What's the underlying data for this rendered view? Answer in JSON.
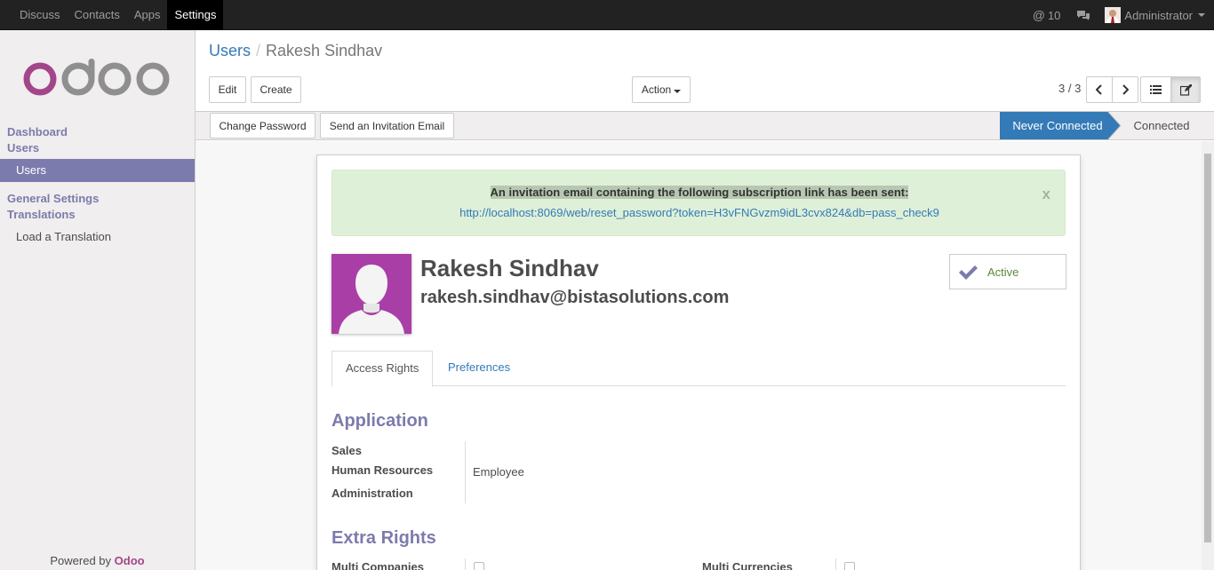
{
  "topbar": {
    "nav": [
      "Discuss",
      "Contacts",
      "Apps",
      "Settings"
    ],
    "active_nav": "Settings",
    "mentions_count": "10",
    "user": "Administrator"
  },
  "sidebar": {
    "logo_text": "odoo",
    "headers": [
      "Dashboard",
      "Users",
      "General Settings",
      "Translations"
    ],
    "items": [
      "Users",
      "Load a Translation"
    ],
    "powered_prefix": "Powered by",
    "powered_brand": "Odoo"
  },
  "breadcrumb": {
    "parent": "Users",
    "separator": "/",
    "current": "Rakesh Sindhav"
  },
  "toolbar": {
    "edit": "Edit",
    "create": "Create",
    "action": "Action",
    "pager": "3 / 3"
  },
  "statusbar": {
    "change_password": "Change Password",
    "send_invitation": "Send an Invitation Email",
    "stages": [
      "Never Connected",
      "Connected"
    ],
    "current_stage": "Never Connected"
  },
  "alert": {
    "message": "An invitation email containing the following subscription link has been sent:",
    "link": "http://localhost:8069/web/reset_password?token=H3vFNGvzm9idL3cvx824&db=pass_check9",
    "close": "x"
  },
  "user": {
    "name": "Rakesh Sindhav",
    "email": "rakesh.sindhav@bistasolutions.com",
    "active_label": "Active"
  },
  "tabs": [
    "Access Rights",
    "Preferences"
  ],
  "application": {
    "title": "Application",
    "fields": [
      {
        "label": "Sales",
        "value": ""
      },
      {
        "label": "Human Resources",
        "value": "Employee"
      },
      {
        "label": "Administration",
        "value": ""
      }
    ]
  },
  "extra_rights": {
    "title": "Extra Rights",
    "fields": [
      {
        "label": "Multi Companies",
        "checked": false
      },
      {
        "label": "Multi Currencies",
        "checked": false
      }
    ]
  },
  "colors": {
    "brand": "#7c7bad",
    "status_active": "#337ab7",
    "alert_bg": "#dff0d8"
  }
}
